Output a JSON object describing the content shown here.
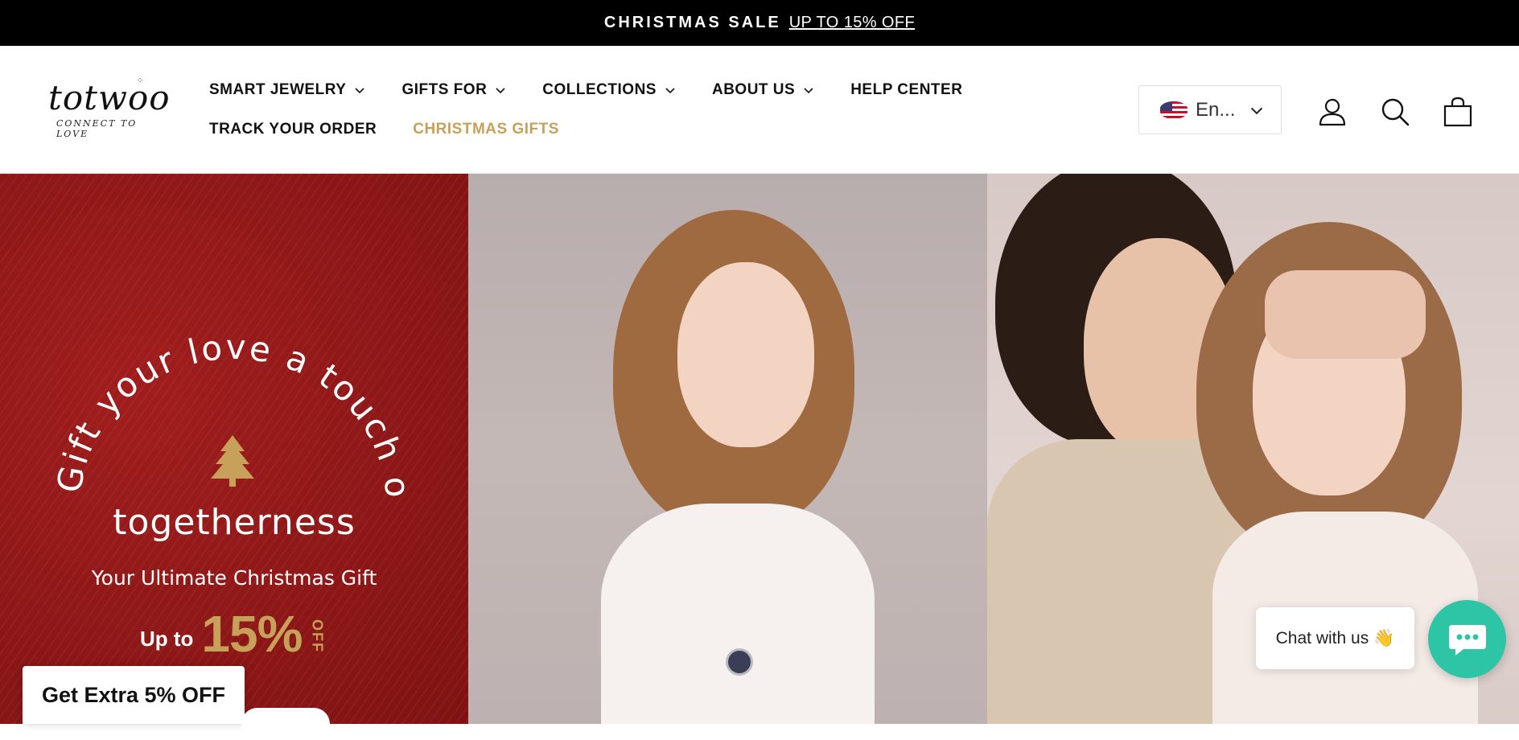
{
  "announcement": {
    "title": "CHRISTMAS SALE",
    "link": "UP TO 15% OFF"
  },
  "brand": {
    "name": "totwoo",
    "tagline": "CONNECT TO LOVE"
  },
  "nav": {
    "row1": [
      {
        "label": "SMART JEWELRY",
        "dropdown": true
      },
      {
        "label": "GIFTS FOR",
        "dropdown": true
      },
      {
        "label": "COLLECTIONS",
        "dropdown": true
      },
      {
        "label": "ABOUT US",
        "dropdown": true
      },
      {
        "label": "HELP CENTER",
        "dropdown": false
      }
    ],
    "row2": [
      {
        "label": "TRACK YOUR ORDER"
      },
      {
        "label": "CHRISTMAS GIFTS",
        "highlight": "#c7a15a"
      }
    ]
  },
  "language": {
    "selected": "En...",
    "flag": "us-flag-icon"
  },
  "header_icons": [
    "account-icon",
    "search-icon",
    "cart-icon"
  ],
  "hero": {
    "arc_text": "Gift your love a touch of",
    "headline": "togetherness",
    "subheadline": "Your Ultimate Christmas Gift",
    "offer_prefix": "Up to",
    "offer_value": "15%",
    "offer_suffix": "OFF",
    "background": "#8f1717",
    "accent": "#c7a15a"
  },
  "promo_tab": {
    "label": "Get Extra 5% OFF"
  },
  "chat": {
    "label": "Chat with us",
    "emoji": "👋",
    "accent": "#2ec4a6"
  }
}
